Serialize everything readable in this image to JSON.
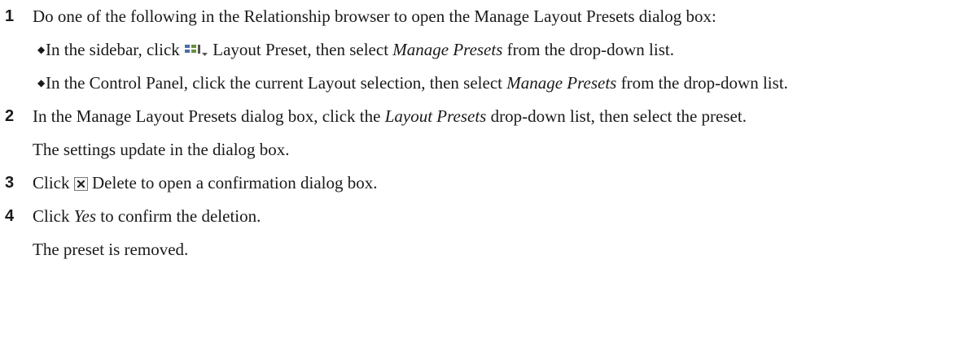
{
  "steps": [
    {
      "number": "1",
      "text": "Do one of the following in the Relationship browser to open the Manage Layout Presets dialog box:",
      "bullets": [
        {
          "t1": "In the sidebar, click ",
          "icon": "layout-preset-icon",
          "t2": " Layout Preset, then select ",
          "em": "Manage Presets",
          "t3": " from the drop-down list."
        },
        {
          "t1": "In the Control Panel, click the current Layout selection, then select ",
          "em": "Manage Presets",
          "t2": " from the drop-down list."
        }
      ]
    },
    {
      "number": "2",
      "t1": "In the Manage Layout Presets dialog box, click the ",
      "em": "Layout Presets",
      "t2": " drop-down list, then select the preset.",
      "result": "The settings update in the dialog box."
    },
    {
      "number": "3",
      "t1": "Click ",
      "icon": "delete-icon",
      "t2": " Delete to open a confirmation dialog box."
    },
    {
      "number": "4",
      "t1": "Click ",
      "em": "Yes",
      "t2": " to confirm the deletion.",
      "result": "The preset is removed."
    }
  ]
}
